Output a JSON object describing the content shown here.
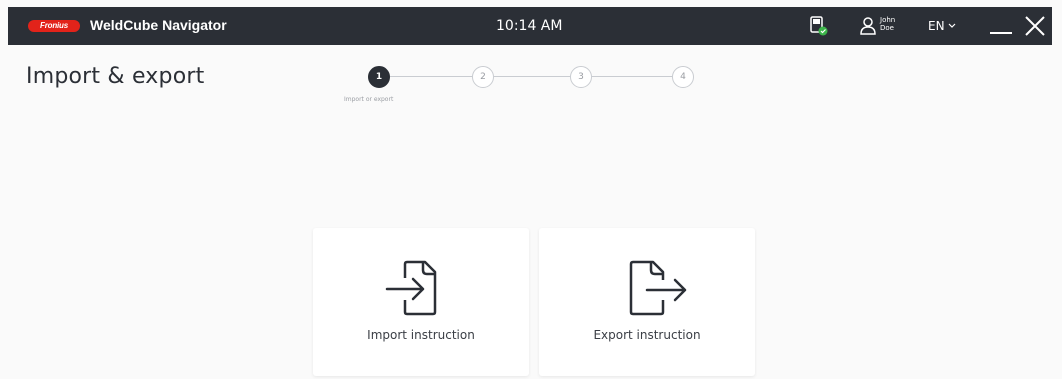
{
  "header": {
    "brand": "Fronius",
    "app_title": "WeldCube Navigator",
    "time": "10:14 AM",
    "user_first": "John",
    "user_last": "Doe",
    "language": "EN"
  },
  "page": {
    "title": "Import & export"
  },
  "stepper": {
    "current": 1,
    "steps": [
      "1",
      "2",
      "3",
      "4"
    ],
    "caption": "Import or export"
  },
  "cards": {
    "import_label": "Import instruction",
    "export_label": "Export instruction"
  },
  "colors": {
    "topbar": "#2b2f36",
    "brand_red": "#e2231a",
    "status_green": "#3cb54a"
  }
}
